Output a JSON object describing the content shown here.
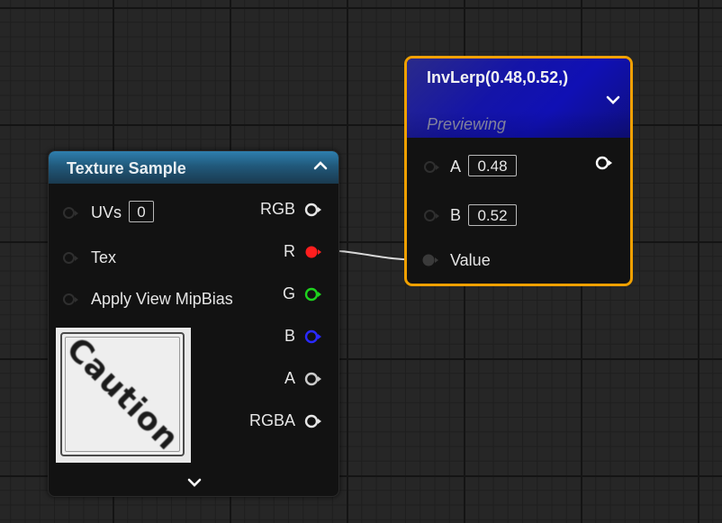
{
  "texture_sample": {
    "title": "Texture Sample",
    "inputs": [
      {
        "label": "UVs",
        "value": "0"
      },
      {
        "label": "Tex"
      },
      {
        "label": "Apply View MipBias"
      }
    ],
    "outputs": [
      {
        "label": "RGB",
        "color": "#e6e6e6"
      },
      {
        "label": "R",
        "color": "#ff1e1e"
      },
      {
        "label": "G",
        "color": "#1ed21e"
      },
      {
        "label": "B",
        "color": "#1e1eff"
      },
      {
        "label": "A",
        "color": "#cccccc"
      },
      {
        "label": "RGBA",
        "color": "#e6e6e6"
      }
    ],
    "thumbnail_text": "Caution"
  },
  "inv_lerp": {
    "title": "InvLerp(0.48,0.52,)",
    "subtitle": "Previewing",
    "inputs": [
      {
        "label": "A",
        "value": "0.48"
      },
      {
        "label": "B",
        "value": "0.52"
      },
      {
        "label": "Value"
      }
    ],
    "output_color": "#ffffff",
    "border_color": "#f0a000"
  },
  "icons": [
    "chevron-up-icon",
    "chevron-down-icon",
    "pin-icon"
  ]
}
